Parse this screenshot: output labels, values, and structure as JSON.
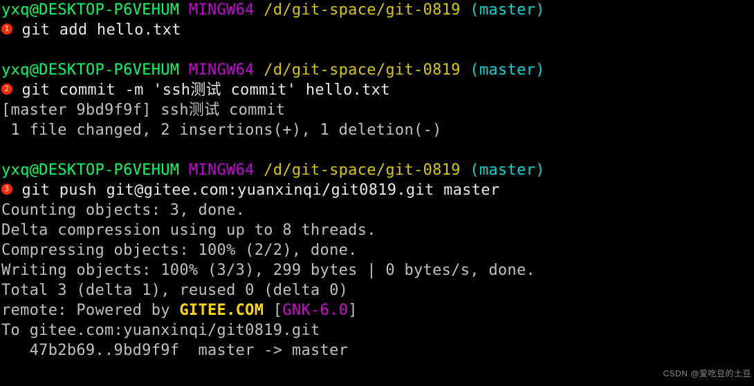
{
  "prompt": {
    "user": "yxq@DESKTOP-P6VEHUM",
    "mingw": "MINGW64",
    "path": "/d/git-space/git-0819",
    "branch": "(master)"
  },
  "bullets": {
    "b1": "1",
    "b2": "2",
    "b3": "3"
  },
  "cmds": {
    "add": " git add hello.txt",
    "commit": " git commit -m 'ssh测试 commit' hello.txt",
    "push": " git push git@gitee.com:yuanxinqi/git0819.git master"
  },
  "out": {
    "commit1": "[master 9bd9f9f] ssh测试 commit",
    "commit2": " 1 file changed, 2 insertions(+), 1 deletion(-)",
    "p1": "Counting objects: 3, done.",
    "p2": "Delta compression using up to 8 threads.",
    "p3": "Compressing objects: 100% (2/2), done.",
    "p4": "Writing objects: 100% (3/3), 299 bytes | 0 bytes/s, done.",
    "p5": "Total 3 (delta 1), reused 0 (delta 0)",
    "p6a": "remote: Powered by ",
    "p6b": "GITEE.COM",
    "p6c": " [",
    "p6d": "GNK-6.0",
    "p6e": "]",
    "p7": "To gitee.com:yuanxinqi/git0819.git",
    "p8": "   47b2b69..9bd9f9f  master -> master"
  },
  "watermark": "CSDN @爱吃豆的土豆"
}
